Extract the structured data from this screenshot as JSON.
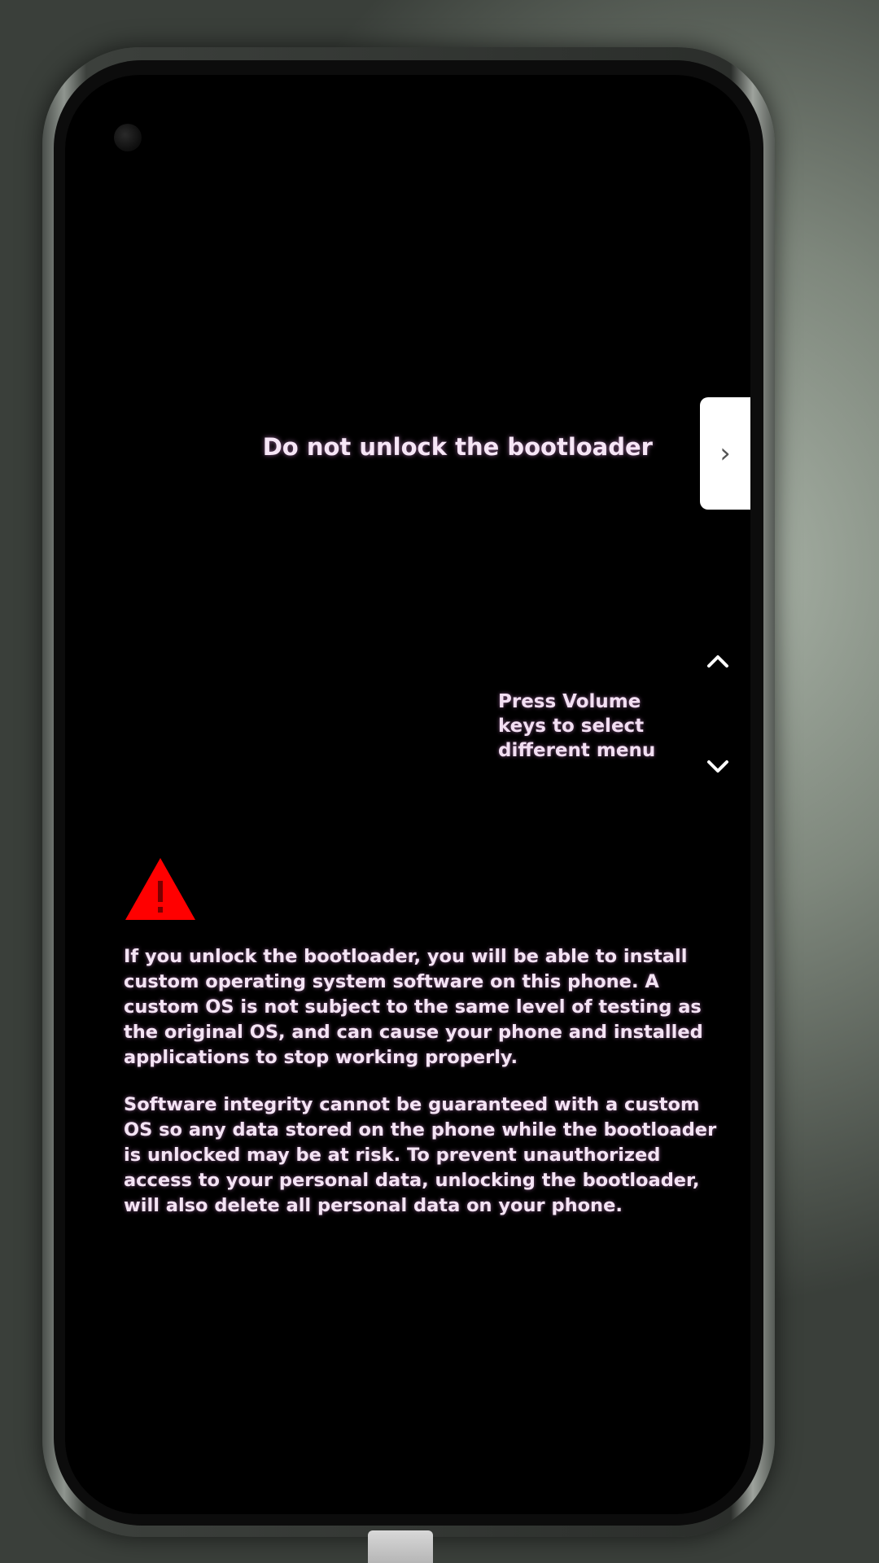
{
  "screen": {
    "menu_option": "Do not unlock the bootloader",
    "menu_arrow": "›",
    "volume_hint": "Press Volume keys to select different menu",
    "volume_up_icon": "chevron-up",
    "volume_down_icon": "chevron-down",
    "warning_icon": "warning-triangle",
    "warning_color": "#ff0000",
    "paragraph_1": "If you unlock the bootloader, you will be able to install custom operating system software on this phone. A custom OS is not subject to the same level of testing as the original OS, and can cause your phone and installed applications to stop working properly.",
    "paragraph_2": "Software integrity cannot be guaranteed with a custom OS so any data stored on the phone while the bootloader is unlocked may be at risk. To prevent unauthorized access to your personal data, unlocking the bootloader, will also delete all personal data on your phone."
  }
}
